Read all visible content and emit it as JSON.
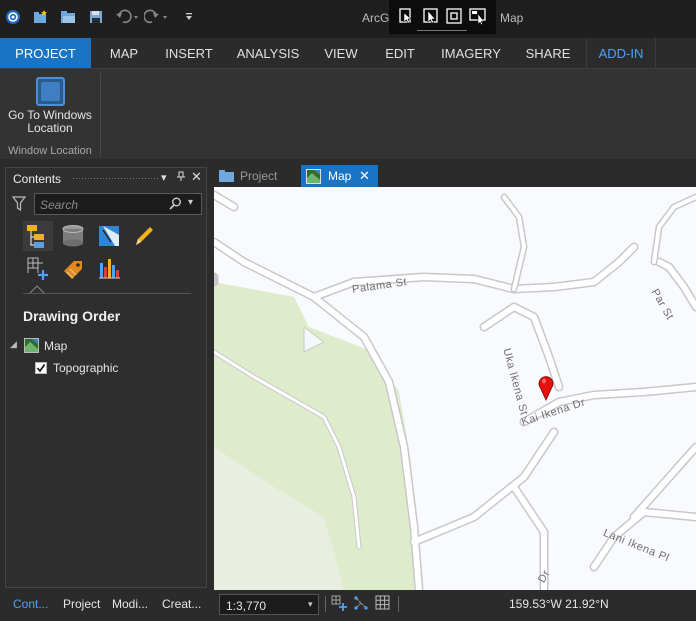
{
  "app": {
    "title_left": "ArcG",
    "title_right": "Map"
  },
  "quick_access": [
    "arcgis-logo-icon",
    "new-project-icon",
    "open-project-icon",
    "save-project-icon",
    "undo-icon",
    "redo-icon",
    "customize-icon"
  ],
  "floating_toolbar": [
    "select-features-icon",
    "select-cursor-icon",
    "clear-selection-icon",
    "select-by-window-icon"
  ],
  "ribbon_tabs": [
    {
      "label": "PROJECT"
    },
    {
      "label": "MAP"
    },
    {
      "label": "INSERT"
    },
    {
      "label": "ANALYSIS"
    },
    {
      "label": "VIEW"
    },
    {
      "label": "EDIT"
    },
    {
      "label": "IMAGERY"
    },
    {
      "label": "SHARE"
    },
    {
      "label": "ADD-IN"
    }
  ],
  "ribbon": {
    "button_label": "Go To Windows Location",
    "group_label": "Window Location"
  },
  "contents": {
    "title": "Contents",
    "search_placeholder": "Search",
    "drawing_order": "Drawing Order",
    "tree": {
      "map_label": "Map",
      "layer_label": "Topographic",
      "layer_checked": true
    }
  },
  "bottom_tabs": [
    "Cont...",
    "Project",
    "Modi...",
    "Creat..."
  ],
  "view_tabs": [
    {
      "label": "Project"
    },
    {
      "label": "Map"
    }
  ],
  "map": {
    "street_labels": [
      "Palama St",
      "Uka Ikena St",
      "Kai Ikena Dr",
      "Par St",
      "Lani Ikena Pl",
      "Dr"
    ],
    "marker_color": "#e8100c",
    "park_color": "#dfeccb"
  },
  "status": {
    "scale": "1:3,770",
    "coordinates": "159.53°W 21.92°N"
  },
  "colors": {
    "accent": "#1a74c6",
    "active_tab_text": "#4ea1ff"
  }
}
